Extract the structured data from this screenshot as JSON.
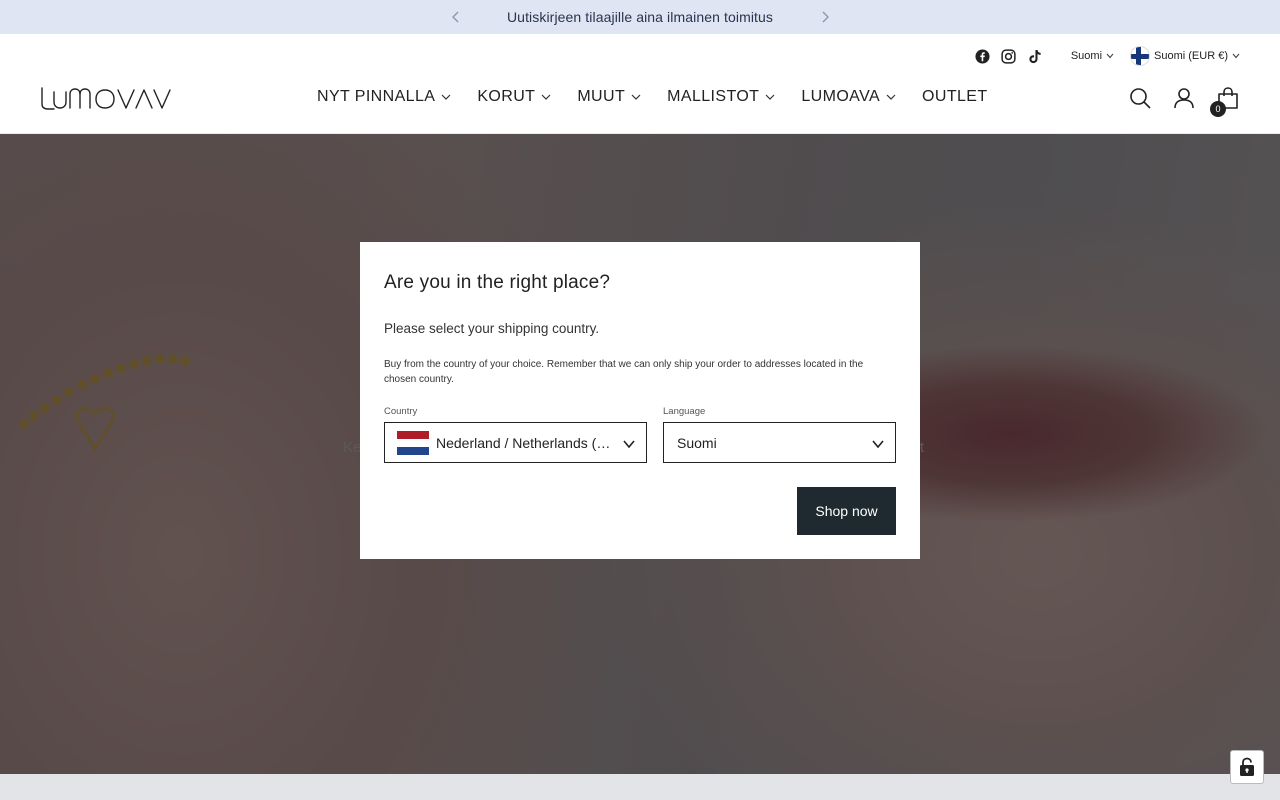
{
  "announcement": {
    "text": "Uutiskirjeen tilaajille aina ilmainen toimitus"
  },
  "header": {
    "utility": {
      "language_label": "Suomi",
      "currency_label": "Suomi (EUR €)"
    },
    "logo_text": "LUMOAVA",
    "nav": [
      {
        "label": "NYT PINNALLA"
      },
      {
        "label": "KORUT"
      },
      {
        "label": "MUUT"
      },
      {
        "label": "MALLISTOT"
      },
      {
        "label": "LUMOAVA"
      },
      {
        "label": "OUTLET"
      }
    ],
    "cart_count": "0"
  },
  "hero": {
    "text_left": "Ke",
    "text_right": "vat"
  },
  "modal": {
    "title": "Are you in the right place?",
    "subtitle": "Please select your shipping country.",
    "description": "Buy from the country of your choice. Remember that we can only ship your order to addresses located in the chosen country.",
    "country_label": "Country",
    "country_value": "Nederland / Netherlands (EUR €)",
    "language_label": "Language",
    "language_value": "Suomi",
    "button_label": "Shop now"
  },
  "colors": {
    "announcement_bg": "#dfe5f2",
    "button_bg": "#1e2a30",
    "flag_nl": [
      "#ae1c28",
      "#ffffff",
      "#21468b"
    ],
    "flag_fi": "#16387a"
  }
}
